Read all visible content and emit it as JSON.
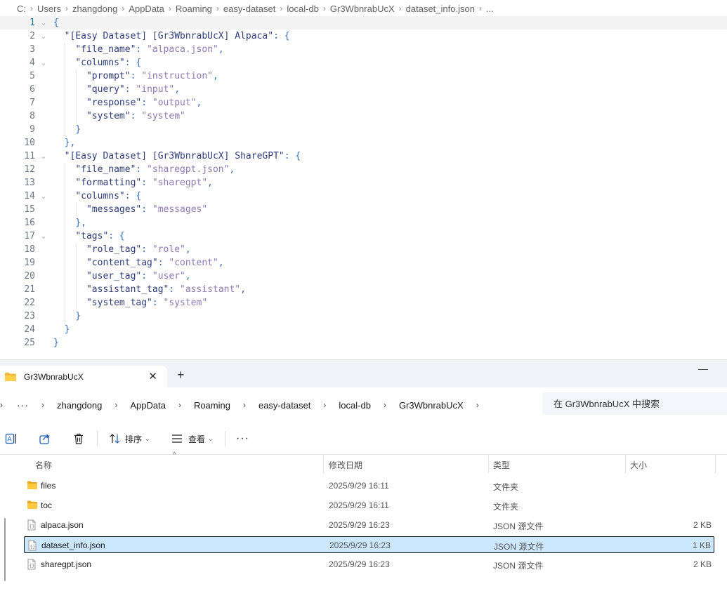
{
  "editor": {
    "breadcrumb": [
      "C:",
      "Users",
      "zhangdong",
      "AppData",
      "Roaming",
      "easy-dataset",
      "local-db",
      "Gr3WbnrabUcX",
      "dataset_info.json",
      "..."
    ],
    "lines": [
      {
        "n": "1",
        "fold": "⌄",
        "tokens": [
          {
            "t": "punc",
            "v": "{"
          }
        ]
      },
      {
        "n": "2",
        "fold": "⌄",
        "tokens": [
          {
            "t": "ws",
            "v": "  "
          },
          {
            "t": "key",
            "v": "\"[Easy Dataset] [Gr3WbnrabUcX] Alpaca\""
          },
          {
            "t": "punc",
            "v": ": {"
          }
        ]
      },
      {
        "n": "3",
        "fold": "",
        "tokens": [
          {
            "t": "ws",
            "v": "    "
          },
          {
            "t": "key",
            "v": "\"file_name\""
          },
          {
            "t": "punc",
            "v": ": "
          },
          {
            "t": "str",
            "v": "\"alpaca.json\""
          },
          {
            "t": "punc",
            "v": ","
          }
        ]
      },
      {
        "n": "4",
        "fold": "⌄",
        "tokens": [
          {
            "t": "ws",
            "v": "    "
          },
          {
            "t": "key",
            "v": "\"columns\""
          },
          {
            "t": "punc",
            "v": ": {"
          }
        ]
      },
      {
        "n": "5",
        "fold": "",
        "tokens": [
          {
            "t": "ws",
            "v": "      "
          },
          {
            "t": "key",
            "v": "\"prompt\""
          },
          {
            "t": "punc",
            "v": ": "
          },
          {
            "t": "str",
            "v": "\"instruction\""
          },
          {
            "t": "punc",
            "v": ","
          }
        ]
      },
      {
        "n": "6",
        "fold": "",
        "tokens": [
          {
            "t": "ws",
            "v": "      "
          },
          {
            "t": "key",
            "v": "\"query\""
          },
          {
            "t": "punc",
            "v": ": "
          },
          {
            "t": "str",
            "v": "\"input\""
          },
          {
            "t": "punc",
            "v": ","
          }
        ]
      },
      {
        "n": "7",
        "fold": "",
        "tokens": [
          {
            "t": "ws",
            "v": "      "
          },
          {
            "t": "key",
            "v": "\"response\""
          },
          {
            "t": "punc",
            "v": ": "
          },
          {
            "t": "str",
            "v": "\"output\""
          },
          {
            "t": "punc",
            "v": ","
          }
        ]
      },
      {
        "n": "8",
        "fold": "",
        "tokens": [
          {
            "t": "ws",
            "v": "      "
          },
          {
            "t": "key",
            "v": "\"system\""
          },
          {
            "t": "punc",
            "v": ": "
          },
          {
            "t": "str",
            "v": "\"system\""
          }
        ]
      },
      {
        "n": "9",
        "fold": "",
        "tokens": [
          {
            "t": "ws",
            "v": "    "
          },
          {
            "t": "punc",
            "v": "}"
          }
        ]
      },
      {
        "n": "10",
        "fold": "",
        "tokens": [
          {
            "t": "ws",
            "v": "  "
          },
          {
            "t": "punc",
            "v": "},"
          }
        ]
      },
      {
        "n": "11",
        "fold": "⌄",
        "tokens": [
          {
            "t": "ws",
            "v": "  "
          },
          {
            "t": "key",
            "v": "\"[Easy Dataset] [Gr3WbnrabUcX] ShareGPT\""
          },
          {
            "t": "punc",
            "v": ": {"
          }
        ]
      },
      {
        "n": "12",
        "fold": "",
        "tokens": [
          {
            "t": "ws",
            "v": "    "
          },
          {
            "t": "key",
            "v": "\"file_name\""
          },
          {
            "t": "punc",
            "v": ": "
          },
          {
            "t": "str",
            "v": "\"sharegpt.json\""
          },
          {
            "t": "punc",
            "v": ","
          }
        ]
      },
      {
        "n": "13",
        "fold": "",
        "tokens": [
          {
            "t": "ws",
            "v": "    "
          },
          {
            "t": "key",
            "v": "\"formatting\""
          },
          {
            "t": "punc",
            "v": ": "
          },
          {
            "t": "str",
            "v": "\"sharegpt\""
          },
          {
            "t": "punc",
            "v": ","
          }
        ]
      },
      {
        "n": "14",
        "fold": "⌄",
        "tokens": [
          {
            "t": "ws",
            "v": "    "
          },
          {
            "t": "key",
            "v": "\"columns\""
          },
          {
            "t": "punc",
            "v": ": {"
          }
        ]
      },
      {
        "n": "15",
        "fold": "",
        "tokens": [
          {
            "t": "ws",
            "v": "      "
          },
          {
            "t": "key",
            "v": "\"messages\""
          },
          {
            "t": "punc",
            "v": ": "
          },
          {
            "t": "str",
            "v": "\"messages\""
          }
        ]
      },
      {
        "n": "16",
        "fold": "",
        "tokens": [
          {
            "t": "ws",
            "v": "    "
          },
          {
            "t": "punc",
            "v": "},"
          }
        ]
      },
      {
        "n": "17",
        "fold": "⌄",
        "tokens": [
          {
            "t": "ws",
            "v": "    "
          },
          {
            "t": "key",
            "v": "\"tags\""
          },
          {
            "t": "punc",
            "v": ": {"
          }
        ]
      },
      {
        "n": "18",
        "fold": "",
        "tokens": [
          {
            "t": "ws",
            "v": "      "
          },
          {
            "t": "key",
            "v": "\"role_tag\""
          },
          {
            "t": "punc",
            "v": ": "
          },
          {
            "t": "str",
            "v": "\"role\""
          },
          {
            "t": "punc",
            "v": ","
          }
        ]
      },
      {
        "n": "19",
        "fold": "",
        "tokens": [
          {
            "t": "ws",
            "v": "      "
          },
          {
            "t": "key",
            "v": "\"content_tag\""
          },
          {
            "t": "punc",
            "v": ": "
          },
          {
            "t": "str",
            "v": "\"content\""
          },
          {
            "t": "punc",
            "v": ","
          }
        ]
      },
      {
        "n": "20",
        "fold": "",
        "tokens": [
          {
            "t": "ws",
            "v": "      "
          },
          {
            "t": "key",
            "v": "\"user_tag\""
          },
          {
            "t": "punc",
            "v": ": "
          },
          {
            "t": "str",
            "v": "\"user\""
          },
          {
            "t": "punc",
            "v": ","
          }
        ]
      },
      {
        "n": "21",
        "fold": "",
        "tokens": [
          {
            "t": "ws",
            "v": "      "
          },
          {
            "t": "key",
            "v": "\"assistant_tag\""
          },
          {
            "t": "punc",
            "v": ": "
          },
          {
            "t": "str",
            "v": "\"assistant\""
          },
          {
            "t": "punc",
            "v": ","
          }
        ]
      },
      {
        "n": "22",
        "fold": "",
        "tokens": [
          {
            "t": "ws",
            "v": "      "
          },
          {
            "t": "key",
            "v": "\"system_tag\""
          },
          {
            "t": "punc",
            "v": ": "
          },
          {
            "t": "str",
            "v": "\"system\""
          }
        ]
      },
      {
        "n": "23",
        "fold": "",
        "tokens": [
          {
            "t": "ws",
            "v": "    "
          },
          {
            "t": "punc",
            "v": "}"
          }
        ]
      },
      {
        "n": "24",
        "fold": "",
        "tokens": [
          {
            "t": "ws",
            "v": "  "
          },
          {
            "t": "punc",
            "v": "}"
          }
        ]
      },
      {
        "n": "25",
        "fold": "",
        "tokens": [
          {
            "t": "punc",
            "v": "}"
          }
        ]
      }
    ]
  },
  "explorer": {
    "tab_title": "Gr3WbnrabUcX",
    "tab_close": "✕",
    "new_tab": "+",
    "minimize": "—",
    "address": {
      "more": "···",
      "segments": [
        "zhangdong",
        "AppData",
        "Roaming",
        "easy-dataset",
        "local-db",
        "Gr3WbnrabUcX"
      ]
    },
    "search_placeholder": "在 Gr3WbnrabUcX 中搜索",
    "toolbar": {
      "sort_label": "排序",
      "view_label": "查看",
      "more": "···"
    },
    "columns": {
      "name": "名称",
      "modified": "修改日期",
      "type": "类型",
      "size": "大小"
    },
    "files": [
      {
        "name": "files",
        "modified": "2025/9/29 16:11",
        "type": "文件夹",
        "size": "",
        "kind": "folder",
        "selected": false
      },
      {
        "name": "toc",
        "modified": "2025/9/29 16:11",
        "type": "文件夹",
        "size": "",
        "kind": "folder",
        "selected": false
      },
      {
        "name": "alpaca.json",
        "modified": "2025/9/29 16:23",
        "type": "JSON 源文件",
        "size": "2 KB",
        "kind": "json",
        "selected": false
      },
      {
        "name": "dataset_info.json",
        "modified": "2025/9/29 16:23",
        "type": "JSON 源文件",
        "size": "1 KB",
        "kind": "json",
        "selected": true
      },
      {
        "name": "sharegpt.json",
        "modified": "2025/9/29 16:23",
        "type": "JSON 源文件",
        "size": "2 KB",
        "kind": "json",
        "selected": false
      }
    ]
  },
  "colors": {
    "folder": "#f0b93a",
    "selection": "#cce8ff",
    "json_key": "#2f3d7a",
    "json_string": "#8d7ab5",
    "json_punctuation": "#3b6fb6"
  }
}
